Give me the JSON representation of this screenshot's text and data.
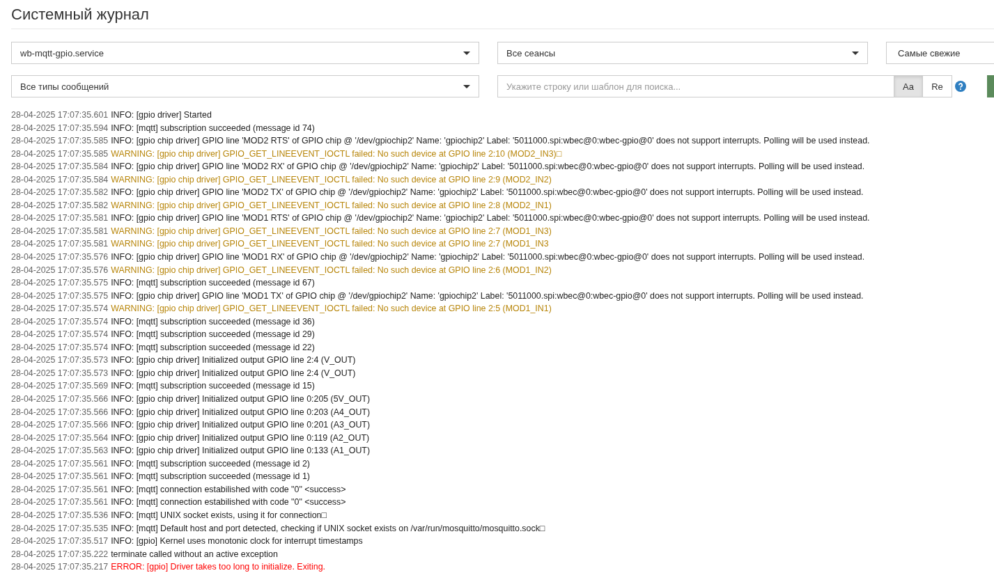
{
  "title": "Системный журнал",
  "filters": {
    "service": "wb-mqtt-gpio.service",
    "sessions": "Все сеансы",
    "order": "Самые свежие",
    "types": "Все типы сообщений"
  },
  "search": {
    "placeholder": "Укажите строку или шаблон для поиска...",
    "toggles": [
      {
        "label": "Aa",
        "selected": true
      },
      {
        "label": "Re",
        "selected": false
      }
    ]
  },
  "log": [
    {
      "time": "28-04-2025 17:07:35.601",
      "kind": "info",
      "message": "INFO: [gpio driver] Started"
    },
    {
      "time": "28-04-2025 17:07:35.594",
      "kind": "info",
      "message": "INFO: [mqtt] subscription succeeded (message id 74)"
    },
    {
      "time": "28-04-2025 17:07:35.585",
      "kind": "info",
      "message": "INFO: [gpio chip driver] GPIO line 'MOD2 RTS' of GPIO chip @ '/dev/gpiochip2' Name: 'gpiochip2' Label: '5011000.spi:wbec@0:wbec-gpio@0' does not support interrupts. Polling will be used instead."
    },
    {
      "time": "28-04-2025 17:07:35.585",
      "kind": "warning",
      "message": "WARNING: [gpio chip driver] GPIO_GET_LINEEVENT_IOCTL failed: No such device at GPIO line 2:10 (MOD2_IN3)□"
    },
    {
      "time": "28-04-2025 17:07:35.584",
      "kind": "info",
      "message": "INFO: [gpio chip driver] GPIO line 'MOD2 RX' of GPIO chip @ '/dev/gpiochip2' Name: 'gpiochip2' Label: '5011000.spi:wbec@0:wbec-gpio@0' does not support interrupts. Polling will be used instead."
    },
    {
      "time": "28-04-2025 17:07:35.584",
      "kind": "warning",
      "message": "WARNING: [gpio chip driver] GPIO_GET_LINEEVENT_IOCTL failed: No such device at GPIO line 2:9 (MOD2_IN2)"
    },
    {
      "time": "28-04-2025 17:07:35.582",
      "kind": "info",
      "message": "INFO: [gpio chip driver] GPIO line 'MOD2 TX' of GPIO chip @ '/dev/gpiochip2' Name: 'gpiochip2' Label: '5011000.spi:wbec@0:wbec-gpio@0' does not support interrupts. Polling will be used instead."
    },
    {
      "time": "28-04-2025 17:07:35.582",
      "kind": "warning",
      "message": "WARNING: [gpio chip driver] GPIO_GET_LINEEVENT_IOCTL failed: No such device at GPIO line 2:8 (MOD2_IN1)"
    },
    {
      "time": "28-04-2025 17:07:35.581",
      "kind": "info",
      "message": "INFO: [gpio chip driver] GPIO line 'MOD1 RTS' of GPIO chip @ '/dev/gpiochip2' Name: 'gpiochip2' Label: '5011000.spi:wbec@0:wbec-gpio@0' does not support interrupts. Polling will be used instead."
    },
    {
      "time": "28-04-2025 17:07:35.581",
      "kind": "warning",
      "message": "WARNING: [gpio chip driver] GPIO_GET_LINEEVENT_IOCTL failed: No such device at GPIO line 2:7 (MOD1_IN3)"
    },
    {
      "time": "28-04-2025 17:07:35.581",
      "kind": "warning",
      "message": "WARNING: [gpio chip driver] GPIO_GET_LINEEVENT_IOCTL failed: No such device at GPIO line 2:7 (MOD1_IN3"
    },
    {
      "time": "28-04-2025 17:07:35.576",
      "kind": "info",
      "message": "INFO: [gpio chip driver] GPIO line 'MOD1 RX' of GPIO chip @ '/dev/gpiochip2' Name: 'gpiochip2' Label: '5011000.spi:wbec@0:wbec-gpio@0' does not support interrupts. Polling will be used instead."
    },
    {
      "time": "28-04-2025 17:07:35.576",
      "kind": "warning",
      "message": "WARNING: [gpio chip driver] GPIO_GET_LINEEVENT_IOCTL failed: No such device at GPIO line 2:6 (MOD1_IN2)"
    },
    {
      "time": "28-04-2025 17:07:35.575",
      "kind": "info",
      "message": "INFO: [mqtt] subscription succeeded (message id 67)"
    },
    {
      "time": "28-04-2025 17:07:35.575",
      "kind": "info",
      "message": "INFO: [gpio chip driver] GPIO line 'MOD1 TX' of GPIO chip @ '/dev/gpiochip2' Name: 'gpiochip2' Label: '5011000.spi:wbec@0:wbec-gpio@0' does not support interrupts. Polling will be used instead."
    },
    {
      "time": "28-04-2025 17:07:35.574",
      "kind": "warning",
      "message": "WARNING: [gpio chip driver] GPIO_GET_LINEEVENT_IOCTL failed: No such device at GPIO line 2:5 (MOD1_IN1)"
    },
    {
      "time": "28-04-2025 17:07:35.574",
      "kind": "info",
      "message": "INFO: [mqtt] subscription succeeded (message id 36)"
    },
    {
      "time": "28-04-2025 17:07:35.574",
      "kind": "info",
      "message": "INFO: [mqtt] subscription succeeded (message id 29)"
    },
    {
      "time": "28-04-2025 17:07:35.574",
      "kind": "info",
      "message": "INFO: [mqtt] subscription succeeded (message id 22)"
    },
    {
      "time": "28-04-2025 17:07:35.573",
      "kind": "info",
      "message": "INFO: [gpio chip driver] Initialized output GPIO line 2:4 (V_OUT)"
    },
    {
      "time": "28-04-2025 17:07:35.573",
      "kind": "info",
      "message": "INFO: [gpio chip driver] Initialized output GPIO line 2:4 (V_OUT)"
    },
    {
      "time": "28-04-2025 17:07:35.569",
      "kind": "info",
      "message": "INFO: [mqtt] subscription succeeded (message id 15)"
    },
    {
      "time": "28-04-2025 17:07:35.566",
      "kind": "info",
      "message": "INFO: [gpio chip driver] Initialized output GPIO line 0:205 (5V_OUT)"
    },
    {
      "time": "28-04-2025 17:07:35.566",
      "kind": "info",
      "message": "INFO: [gpio chip driver] Initialized output GPIO line 0:203 (A4_OUT)"
    },
    {
      "time": "28-04-2025 17:07:35.566",
      "kind": "info",
      "message": "INFO: [gpio chip driver] Initialized output GPIO line 0:201 (A3_OUT)"
    },
    {
      "time": "28-04-2025 17:07:35.564",
      "kind": "info",
      "message": "INFO: [gpio chip driver] Initialized output GPIO line 0:119 (A2_OUT)"
    },
    {
      "time": "28-04-2025 17:07:35.563",
      "kind": "info",
      "message": "INFO: [gpio chip driver] Initialized output GPIO line 0:133 (A1_OUT)"
    },
    {
      "time": "28-04-2025 17:07:35.561",
      "kind": "info",
      "message": "INFO: [mqtt] subscription succeeded (message id 2)"
    },
    {
      "time": "28-04-2025 17:07:35.561",
      "kind": "info",
      "message": "INFO: [mqtt] subscription succeeded (message id 1)"
    },
    {
      "time": "28-04-2025 17:07:35.561",
      "kind": "info",
      "message": "INFO: [mqtt] connection estabilished with code \"0\" <success>"
    },
    {
      "time": "28-04-2025 17:07:35.561",
      "kind": "info",
      "message": "INFO: [mqtt] connection estabilished with code \"0\" <success>"
    },
    {
      "time": "28-04-2025 17:07:35.536",
      "kind": "info",
      "message": "INFO: [mqtt] UNIX socket exists, using it for connection□"
    },
    {
      "time": "28-04-2025 17:07:35.535",
      "kind": "info",
      "message": "INFO: [mqtt] Default host and port detected, checking if UNIX socket exists on /var/run/mosquitto/mosquitto.sock□"
    },
    {
      "time": "28-04-2025 17:07:35.517",
      "kind": "info",
      "message": "INFO: [gpio] Kernel uses monotonic clock for interrupt timestamps"
    },
    {
      "time": "28-04-2025 17:07:35.222",
      "kind": "plain",
      "message": "terminate called without an active exception"
    },
    {
      "time": "28-04-2025 17:07:35.217",
      "kind": "error",
      "message": "ERROR: [gpio] Driver takes too long to initialize. Exiting."
    }
  ]
}
